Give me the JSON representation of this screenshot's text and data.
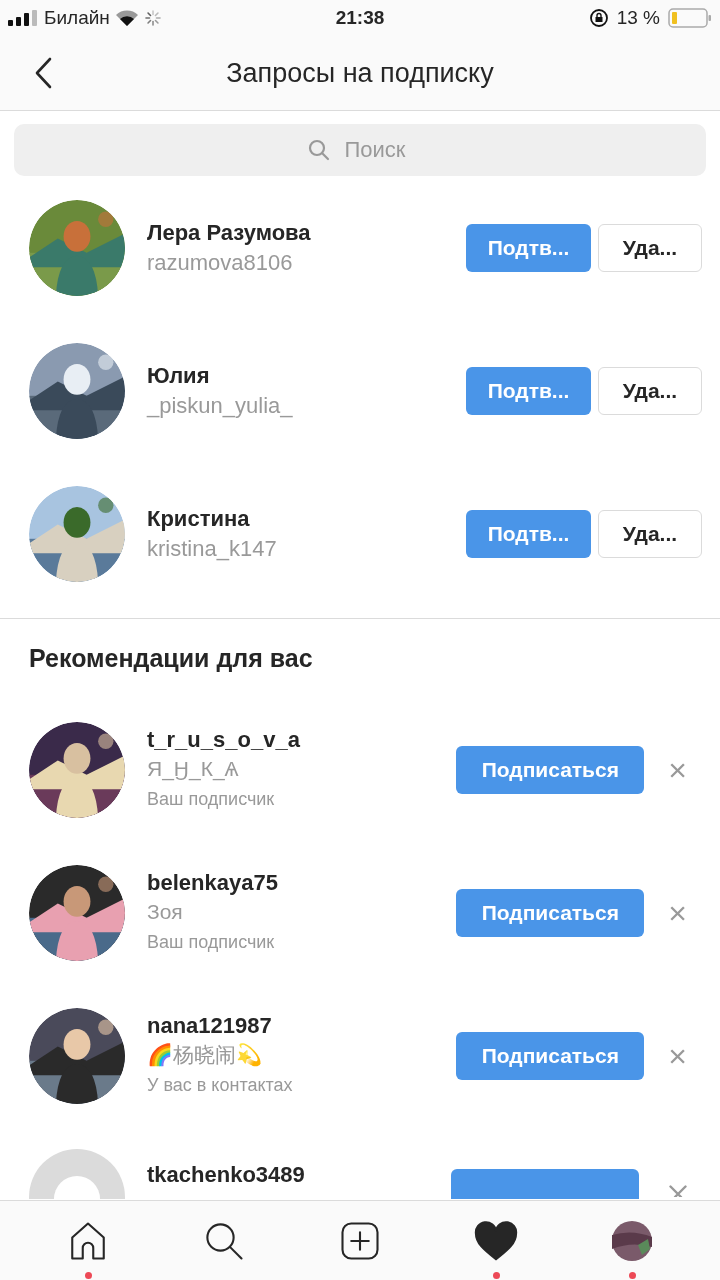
{
  "status_bar": {
    "carrier": "Билайн",
    "time": "21:38",
    "battery": "13 %"
  },
  "header": {
    "title": "Запросы на подписку"
  },
  "search": {
    "placeholder": "Поиск"
  },
  "requests": [
    {
      "name": "Лера Разумова",
      "username": "razumova8106",
      "confirm": "Подтв...",
      "delete": "Уда..."
    },
    {
      "name": "Юлия",
      "username": "_piskun_yulia_",
      "confirm": "Подтв...",
      "delete": "Уда..."
    },
    {
      "name": "Кристина",
      "username": "kristina_k147",
      "confirm": "Подтв...",
      "delete": "Уда..."
    }
  ],
  "suggestions_title": "Рекомендации для вас",
  "suggestions": [
    {
      "username": "t_r_u_s_o_v_a",
      "full_name": "Я_Ӈ_К_Ѧ",
      "reason": "Ваш подписчик",
      "follow": "Подписаться",
      "dismiss": "×",
      "cut_off": false
    },
    {
      "username": "belenkaya75",
      "full_name": "Зоя",
      "reason": "Ваш подписчик",
      "follow": "Подписаться",
      "dismiss": "×",
      "cut_off": false
    },
    {
      "username": "nana121987",
      "full_name": "🌈杨晓闹💫",
      "reason": "У вас в контактах",
      "follow": "Подписаться",
      "dismiss": "×",
      "cut_off": false
    },
    {
      "username": "tkachenko3489",
      "cut_off": true
    }
  ],
  "tab_bar": [
    {
      "selected": false,
      "badge": true
    },
    {
      "selected": false,
      "badge": false
    },
    {
      "selected": false,
      "badge": false
    },
    {
      "selected": true,
      "badge": true
    },
    {
      "selected": false,
      "badge": true
    }
  ]
}
